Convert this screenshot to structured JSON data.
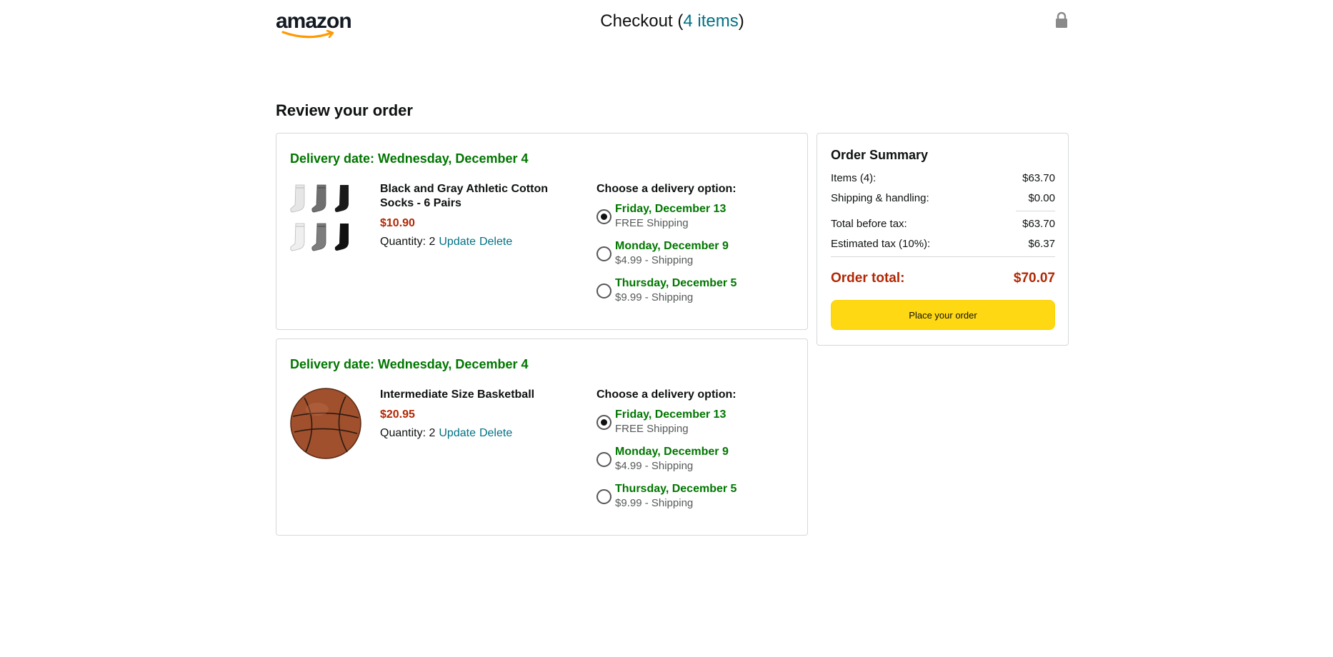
{
  "header": {
    "logo_text": "amazon",
    "checkout_label": "Checkout (",
    "item_count_link": "4 items",
    "checkout_suffix": ")",
    "lock_icon": "lock-icon"
  },
  "page_title": "Review your order",
  "orders": [
    {
      "delivery_date": "Delivery date: Wednesday, December 4",
      "product_name": "Black and Gray Athletic Cotton Socks - 6 Pairs",
      "price": "$10.90",
      "quantity_label": "Quantity: 2",
      "update_label": "Update",
      "delete_label": "Delete",
      "image": "socks-image",
      "options_title": "Choose a delivery option:",
      "options": [
        {
          "date": "Friday, December 13",
          "cost": "FREE Shipping",
          "selected": true
        },
        {
          "date": "Monday, December 9",
          "cost": "$4.99 - Shipping",
          "selected": false
        },
        {
          "date": "Thursday, December 5",
          "cost": "$9.99 - Shipping",
          "selected": false
        }
      ]
    },
    {
      "delivery_date": "Delivery date: Wednesday, December 4",
      "product_name": "Intermediate Size Basketball",
      "price": "$20.95",
      "quantity_label": "Quantity: 2",
      "update_label": "Update",
      "delete_label": "Delete",
      "image": "basketball-image",
      "options_title": "Choose a delivery option:",
      "options": [
        {
          "date": "Friday, December 13",
          "cost": "FREE Shipping",
          "selected": true
        },
        {
          "date": "Monday, December 9",
          "cost": "$4.99 - Shipping",
          "selected": false
        },
        {
          "date": "Thursday, December 5",
          "cost": "$9.99 - Shipping",
          "selected": false
        }
      ]
    }
  ],
  "summary": {
    "title": "Order Summary",
    "items_label": "Items (4):",
    "items_value": "$63.70",
    "shipping_label": "Shipping & handling:",
    "shipping_value": "$0.00",
    "before_tax_label": "Total before tax:",
    "before_tax_value": "$63.70",
    "tax_label": "Estimated tax (10%):",
    "tax_value": "$6.37",
    "total_label": "Order total:",
    "total_value": "$70.07",
    "place_order_label": "Place your order"
  },
  "colors": {
    "accent_green": "#007600",
    "price_red": "#b12704",
    "link_teal": "#017185",
    "button_yellow": "#ffd814"
  }
}
